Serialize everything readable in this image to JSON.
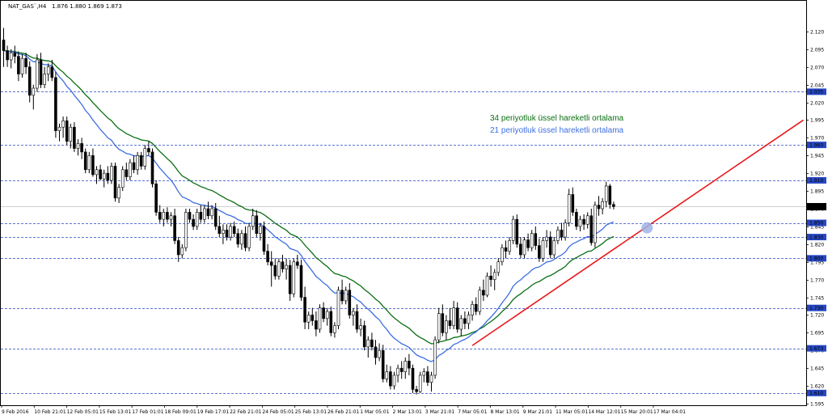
{
  "header": {
    "symbol": "NAT_GAS`,H4",
    "ohlc": "1.876 1.880 1.869 1.873"
  },
  "annotations": {
    "ema34": "34 periyotluk üssel hareketli ortalama",
    "ema21": "21 periyotluk üssel hareketli ortalama"
  },
  "colors": {
    "bull": "#ffffff",
    "bear": "#000000",
    "candle_outline": "#000000",
    "ema34": "#0a6e12",
    "ema21": "#3d6ee0",
    "trendline": "#e8171b",
    "hline": "#2748c4",
    "hline_tag_bg": "#2748c4",
    "current_tag_bg": "#000000",
    "highlight": "#9fb3e8"
  },
  "chart_data": {
    "type": "candlestick",
    "title": "NAT_GAS`,H4",
    "ylim": [
      1.595,
      2.145
    ],
    "y_ticks": [
      "2.120",
      "2.095",
      "2.070",
      "2.045",
      "2.020",
      "1.995",
      "1.970",
      "1.945",
      "1.920",
      "1.895",
      "1.870",
      "1.845",
      "1.820",
      "1.795",
      "1.770",
      "1.745",
      "1.720",
      "1.695",
      "1.670",
      "1.645",
      "1.620",
      "1.595"
    ],
    "x_tick_labels": [
      "9 Feb 2016",
      "10 Feb 21:01",
      "12 Feb 05:01",
      "15 Feb 13:01",
      "17 Feb 01:01",
      "18 Feb 09:01",
      "19 Feb 17:01",
      "22 Feb 21:01",
      "24 Feb 05:01",
      "25 Feb 13:01",
      "26 Feb 21:01",
      "1 Mar 05:01",
      "2 Mar 13:01",
      "3 Mar 21:01",
      "7 Mar 05:01",
      "8 Mar 13:01",
      "9 Mar 21:01",
      "11 Mar 05:01",
      "14 Mar 12:01",
      "15 Mar 20:01",
      "17 Mar 04:01"
    ],
    "horizontal_levels": [
      {
        "value": 2.035,
        "label": "2.035"
      },
      {
        "value": 1.96,
        "label": "1.960"
      },
      {
        "value": 1.91,
        "label": "1.910"
      },
      {
        "value": 1.85,
        "label": "1.850"
      },
      {
        "value": 1.83,
        "label": "1.830"
      },
      {
        "value": 1.8,
        "label": "1.800"
      },
      {
        "value": 1.73,
        "label": "1.730"
      },
      {
        "value": 1.673,
        "label": "1.673"
      },
      {
        "value": 1.61,
        "label": "1.610"
      }
    ],
    "current_price": {
      "value": 1.873,
      "label": "1.873"
    },
    "trendline": {
      "start_bar": 126,
      "start_price": 1.677,
      "end_bar": 215,
      "end_price": 1.995
    },
    "highlight_point": {
      "bar": 173,
      "price": 1.843
    },
    "candles": [
      [
        2.108,
        2.125,
        2.07,
        2.093
      ],
      [
        2.093,
        2.1,
        2.07,
        2.08
      ],
      [
        2.08,
        2.095,
        2.068,
        2.09
      ],
      [
        2.09,
        2.1,
        2.075,
        2.085
      ],
      [
        2.085,
        2.092,
        2.05,
        2.06
      ],
      [
        2.06,
        2.088,
        2.055,
        2.082
      ],
      [
        2.082,
        2.09,
        2.06,
        2.07
      ],
      [
        2.07,
        2.078,
        2.02,
        2.03
      ],
      [
        2.03,
        2.045,
        2.01,
        2.04
      ],
      [
        2.04,
        2.088,
        2.035,
        2.08
      ],
      [
        2.08,
        2.09,
        2.04,
        2.045
      ],
      [
        2.045,
        2.07,
        2.04,
        2.06
      ],
      [
        2.06,
        2.075,
        2.05,
        2.07
      ],
      [
        2.07,
        2.08,
        2.05,
        2.055
      ],
      [
        2.055,
        2.063,
        1.97,
        1.98
      ],
      [
        1.98,
        1.99,
        1.965,
        1.985
      ],
      [
        1.985,
        2.0,
        1.97,
        1.994
      ],
      [
        1.994,
        2.0,
        1.96,
        1.965
      ],
      [
        1.965,
        1.99,
        1.955,
        1.985
      ],
      [
        1.985,
        1.992,
        1.95,
        1.955
      ],
      [
        1.955,
        1.968,
        1.945,
        1.962
      ],
      [
        1.962,
        1.97,
        1.94,
        1.95
      ],
      [
        1.95,
        1.955,
        1.92,
        1.925
      ],
      [
        1.925,
        1.95,
        1.92,
        1.945
      ],
      [
        1.945,
        1.955,
        1.915,
        1.918
      ],
      [
        1.918,
        1.93,
        1.905,
        1.925
      ],
      [
        1.925,
        1.932,
        1.91,
        1.912
      ],
      [
        1.912,
        1.925,
        1.9,
        1.92
      ],
      [
        1.92,
        1.93,
        1.905,
        1.91
      ],
      [
        1.91,
        1.935,
        1.905,
        1.93
      ],
      [
        1.93,
        1.935,
        1.88,
        1.885
      ],
      [
        1.885,
        1.905,
        1.878,
        1.9
      ],
      [
        1.9,
        1.93,
        1.895,
        1.925
      ],
      [
        1.925,
        1.935,
        1.91,
        1.915
      ],
      [
        1.915,
        1.94,
        1.91,
        1.935
      ],
      [
        1.935,
        1.945,
        1.92,
        1.925
      ],
      [
        1.925,
        1.95,
        1.918,
        1.945
      ],
      [
        1.945,
        1.95,
        1.925,
        1.93
      ],
      [
        1.93,
        1.96,
        1.925,
        1.955
      ],
      [
        1.955,
        1.965,
        1.945,
        1.95
      ],
      [
        1.95,
        1.955,
        1.9,
        1.905
      ],
      [
        1.905,
        1.91,
        1.86,
        1.865
      ],
      [
        1.865,
        1.875,
        1.85,
        1.855
      ],
      [
        1.855,
        1.87,
        1.845,
        1.865
      ],
      [
        1.865,
        1.872,
        1.85,
        1.855
      ],
      [
        1.855,
        1.865,
        1.845,
        1.86
      ],
      [
        1.86,
        1.87,
        1.82,
        1.825
      ],
      [
        1.825,
        1.83,
        1.795,
        1.805
      ],
      [
        1.805,
        1.82,
        1.8,
        1.815
      ],
      [
        1.815,
        1.87,
        1.81,
        1.865
      ],
      [
        1.865,
        1.87,
        1.85,
        1.855
      ],
      [
        1.855,
        1.862,
        1.84,
        1.845
      ],
      [
        1.845,
        1.87,
        1.84,
        1.865
      ],
      [
        1.865,
        1.875,
        1.85,
        1.855
      ],
      [
        1.855,
        1.875,
        1.85,
        1.87
      ],
      [
        1.87,
        1.88,
        1.855,
        1.86
      ],
      [
        1.86,
        1.875,
        1.855,
        1.87
      ],
      [
        1.87,
        1.878,
        1.84,
        1.845
      ],
      [
        1.845,
        1.86,
        1.83,
        1.835
      ],
      [
        1.835,
        1.848,
        1.82,
        1.84
      ],
      [
        1.84,
        1.848,
        1.825,
        1.83
      ],
      [
        1.83,
        1.85,
        1.825,
        1.845
      ],
      [
        1.845,
        1.852,
        1.83,
        1.835
      ],
      [
        1.835,
        1.842,
        1.815,
        1.82
      ],
      [
        1.82,
        1.84,
        1.812,
        1.835
      ],
      [
        1.835,
        1.845,
        1.81,
        1.815
      ],
      [
        1.815,
        1.85,
        1.81,
        1.845
      ],
      [
        1.845,
        1.87,
        1.84,
        1.86
      ],
      [
        1.86,
        1.868,
        1.83,
        1.835
      ],
      [
        1.835,
        1.85,
        1.825,
        1.845
      ],
      [
        1.845,
        1.852,
        1.805,
        1.81
      ],
      [
        1.81,
        1.82,
        1.79,
        1.795
      ],
      [
        1.795,
        1.81,
        1.76,
        1.79
      ],
      [
        1.79,
        1.8,
        1.77,
        1.775
      ],
      [
        1.775,
        1.8,
        1.77,
        1.795
      ],
      [
        1.795,
        1.805,
        1.78,
        1.785
      ],
      [
        1.785,
        1.8,
        1.77,
        1.79
      ],
      [
        1.79,
        1.798,
        1.74,
        1.75
      ],
      [
        1.75,
        1.8,
        1.745,
        1.795
      ],
      [
        1.795,
        1.805,
        1.785,
        1.79
      ],
      [
        1.79,
        1.798,
        1.74,
        1.745
      ],
      [
        1.745,
        1.76,
        1.7,
        1.71
      ],
      [
        1.71,
        1.725,
        1.7,
        1.72
      ],
      [
        1.72,
        1.73,
        1.705,
        1.712
      ],
      [
        1.712,
        1.725,
        1.69,
        1.7
      ],
      [
        1.7,
        1.735,
        1.695,
        1.73
      ],
      [
        1.73,
        1.738,
        1.71,
        1.715
      ],
      [
        1.715,
        1.73,
        1.705,
        1.725
      ],
      [
        1.725,
        1.732,
        1.69,
        1.695
      ],
      [
        1.695,
        1.71,
        1.688,
        1.705
      ],
      [
        1.705,
        1.76,
        1.7,
        1.755
      ],
      [
        1.755,
        1.77,
        1.735,
        1.74
      ],
      [
        1.74,
        1.76,
        1.735,
        1.755
      ],
      [
        1.755,
        1.765,
        1.715,
        1.72
      ],
      [
        1.72,
        1.73,
        1.705,
        1.725
      ],
      [
        1.725,
        1.735,
        1.695,
        1.7
      ],
      [
        1.7,
        1.715,
        1.69,
        1.705
      ],
      [
        1.705,
        1.712,
        1.67,
        1.675
      ],
      [
        1.675,
        1.69,
        1.66,
        1.685
      ],
      [
        1.685,
        1.695,
        1.67,
        1.675
      ],
      [
        1.675,
        1.685,
        1.65,
        1.66
      ],
      [
        1.66,
        1.68,
        1.655,
        1.67
      ],
      [
        1.67,
        1.678,
        1.625,
        1.63
      ],
      [
        1.63,
        1.65,
        1.625,
        1.64
      ],
      [
        1.64,
        1.648,
        1.615,
        1.62
      ],
      [
        1.62,
        1.64,
        1.615,
        1.635
      ],
      [
        1.635,
        1.65,
        1.625,
        1.645
      ],
      [
        1.645,
        1.655,
        1.63,
        1.64
      ],
      [
        1.64,
        1.66,
        1.63,
        1.655
      ],
      [
        1.655,
        1.665,
        1.635,
        1.645
      ],
      [
        1.645,
        1.65,
        1.61,
        1.615
      ],
      [
        1.615,
        1.62,
        1.608,
        1.612
      ],
      [
        1.612,
        1.64,
        1.61,
        1.635
      ],
      [
        1.635,
        1.645,
        1.625,
        1.64
      ],
      [
        1.64,
        1.648,
        1.62,
        1.625
      ],
      [
        1.625,
        1.64,
        1.612,
        1.635
      ],
      [
        1.635,
        1.69,
        1.63,
        1.685
      ],
      [
        1.685,
        1.73,
        1.68,
        1.722
      ],
      [
        1.722,
        1.735,
        1.69,
        1.695
      ],
      [
        1.695,
        1.72,
        1.685,
        1.712
      ],
      [
        1.712,
        1.73,
        1.7,
        1.705
      ],
      [
        1.705,
        1.74,
        1.7,
        1.73
      ],
      [
        1.73,
        1.738,
        1.695,
        1.7
      ],
      [
        1.7,
        1.72,
        1.69,
        1.715
      ],
      [
        1.715,
        1.725,
        1.7,
        1.708
      ],
      [
        1.708,
        1.725,
        1.7,
        1.72
      ],
      [
        1.72,
        1.74,
        1.712,
        1.735
      ],
      [
        1.735,
        1.745,
        1.72,
        1.725
      ],
      [
        1.725,
        1.76,
        1.72,
        1.755
      ],
      [
        1.755,
        1.77,
        1.74,
        1.748
      ],
      [
        1.748,
        1.78,
        1.745,
        1.775
      ],
      [
        1.775,
        1.79,
        1.76,
        1.77
      ],
      [
        1.77,
        1.785,
        1.755,
        1.78
      ],
      [
        1.78,
        1.8,
        1.775,
        1.795
      ],
      [
        1.795,
        1.82,
        1.79,
        1.815
      ],
      [
        1.815,
        1.825,
        1.8,
        1.81
      ],
      [
        1.81,
        1.83,
        1.805,
        1.825
      ],
      [
        1.825,
        1.86,
        1.82,
        1.855
      ],
      [
        1.855,
        1.862,
        1.815,
        1.82
      ],
      [
        1.82,
        1.83,
        1.8,
        1.805
      ],
      [
        1.805,
        1.83,
        1.8,
        1.826
      ],
      [
        1.826,
        1.835,
        1.81,
        1.815
      ],
      [
        1.815,
        1.84,
        1.81,
        1.835
      ],
      [
        1.835,
        1.845,
        1.812,
        1.818
      ],
      [
        1.818,
        1.828,
        1.795,
        1.8
      ],
      [
        1.8,
        1.83,
        1.795,
        1.825
      ],
      [
        1.825,
        1.84,
        1.815,
        1.83
      ],
      [
        1.83,
        1.838,
        1.8,
        1.805
      ],
      [
        1.805,
        1.83,
        1.8,
        1.825
      ],
      [
        1.825,
        1.845,
        1.82,
        1.84
      ],
      [
        1.84,
        1.85,
        1.825,
        1.83
      ],
      [
        1.83,
        1.855,
        1.825,
        1.85
      ],
      [
        1.85,
        1.898,
        1.845,
        1.89
      ],
      [
        1.89,
        1.9,
        1.86,
        1.865
      ],
      [
        1.865,
        1.87,
        1.84,
        1.845
      ],
      [
        1.845,
        1.86,
        1.838,
        1.855
      ],
      [
        1.855,
        1.862,
        1.84,
        1.848
      ],
      [
        1.848,
        1.865,
        1.842,
        1.86
      ],
      [
        1.86,
        1.87,
        1.818,
        1.822
      ],
      [
        1.822,
        1.88,
        1.815,
        1.875
      ],
      [
        1.875,
        1.888,
        1.86,
        1.87
      ],
      [
        1.87,
        1.885,
        1.862,
        1.88
      ],
      [
        1.88,
        1.908,
        1.872,
        1.902
      ],
      [
        1.902,
        1.905,
        1.87,
        1.876
      ],
      [
        1.876,
        1.88,
        1.869,
        1.873
      ]
    ]
  }
}
